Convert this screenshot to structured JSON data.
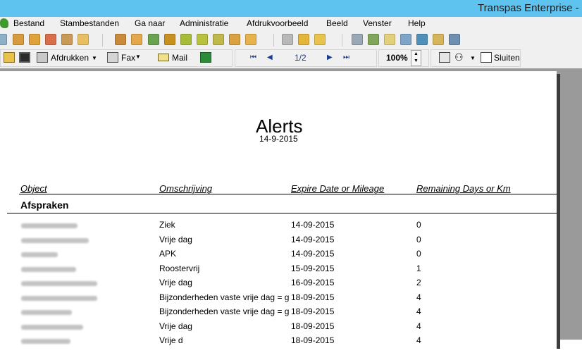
{
  "window": {
    "title": "Transpas Enterprise - M"
  },
  "menu": [
    {
      "label": "Bestand"
    },
    {
      "label": "Stambestanden"
    },
    {
      "label": "Ga naar"
    },
    {
      "label": "Administratie"
    },
    {
      "label": "Afdrukvoorbeeld"
    },
    {
      "label": "Beeld"
    },
    {
      "label": "Venster"
    },
    {
      "label": "Help"
    }
  ],
  "toolbar": {
    "print_label": "Afdrukken",
    "fax_label": "Fax",
    "mail_label": "Mail",
    "page_indicator": "1/2",
    "zoom": "100%",
    "close_label": "Sluiten"
  },
  "report": {
    "title": "Alerts",
    "date": "14-9-2015",
    "columns": [
      "Object",
      "Omschrijving",
      "Expire Date or Mileage",
      "Remaining Days or Km"
    ],
    "group": "Afspraken",
    "rows": [
      {
        "description": "Ziek",
        "date": "14-09-2015",
        "remaining": "0"
      },
      {
        "description": "Vrije dag",
        "date": "14-09-2015",
        "remaining": "0"
      },
      {
        "description": "APK",
        "date": "14-09-2015",
        "remaining": "0"
      },
      {
        "description": "Roostervrij",
        "date": "15-09-2015",
        "remaining": "1"
      },
      {
        "description": "Vrije dag",
        "date": "16-09-2015",
        "remaining": "2"
      },
      {
        "description": "Bijzonderheden vaste vrije dag = g",
        "date": "18-09-2015",
        "remaining": "4"
      },
      {
        "description": "Bijzonderheden vaste vrije dag = g",
        "date": "18-09-2015",
        "remaining": "4"
      },
      {
        "description": "Vrije dag",
        "date": "18-09-2015",
        "remaining": "4"
      },
      {
        "description": "Vrije d",
        "date": "18-09-2015",
        "remaining": "4"
      }
    ]
  },
  "colors": {
    "titlebar": "#5ec3ef",
    "chrome": "#f0f0f0",
    "workspace": "#9a9a9a"
  }
}
